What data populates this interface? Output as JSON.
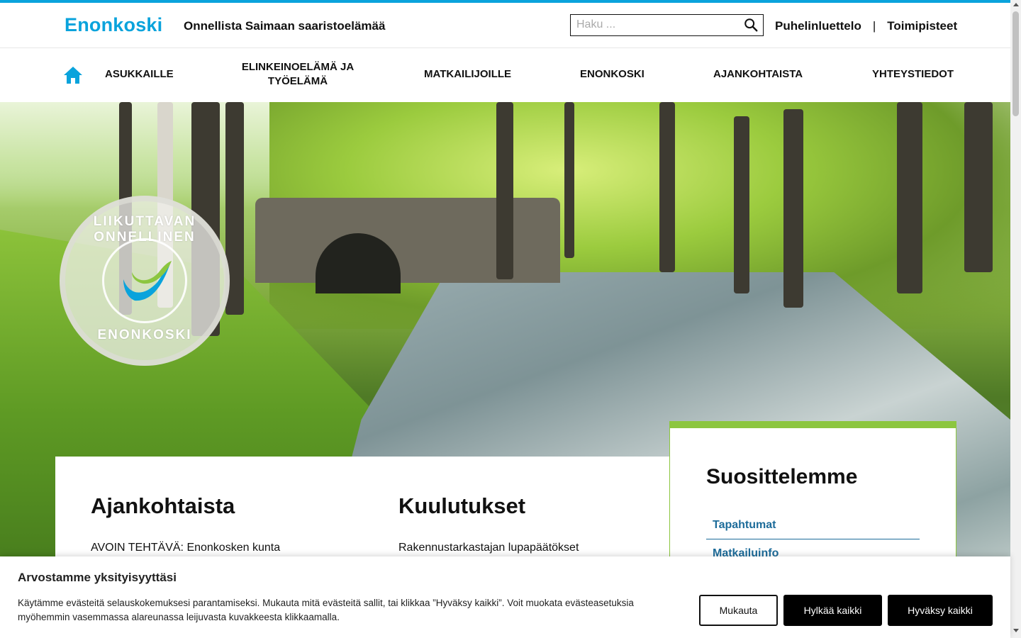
{
  "header": {
    "logo": "Enonkoski",
    "tagline": "Onnellista Saimaan saaristoelämää",
    "search_placeholder": "Haku ...",
    "links": [
      "Puhelinluettelo",
      "Toimipisteet"
    ],
    "separator": "|"
  },
  "nav": {
    "items": [
      "ASUKKAILLE",
      "ELINKEINOELÄMÄ JA TYÖELÄMÄ",
      "MATKAILIJOILLE",
      "ENONKOSKI",
      "AJANKOHTAISTA",
      "YHTEYSTIEDOT"
    ]
  },
  "hero": {
    "badge_top": "LIIKUTTAVAN ONNELLINEN",
    "badge_bottom": "ENONKOSKI"
  },
  "main": {
    "news_title": "Ajankohtaista",
    "news_first": "AVOIN TEHTÄVÄ: Enonkosken kunta",
    "announcements_title": "Kuulutukset",
    "announcements_first": "Rakennustarkastajan lupapäätökset"
  },
  "recommend": {
    "title": "Suosittelemme",
    "links": [
      "Tapahtumat",
      "Matkailuinfo"
    ]
  },
  "cookie": {
    "title": "Arvostamme yksityisyyttäsi",
    "text": "Käytämme evästeitä selauskokemuksesi parantamiseksi. Mukauta mitä evästeitä sallit, tai klikkaa ”Hyväksy kaikki”. Voit muokata evästeasetuksia myöhemmin vasemmassa alareunassa leijuvasta kuvakkeesta klikkaamalla.",
    "customize": "Mukauta",
    "reject": "Hylkää kaikki",
    "accept": "Hyväksy kaikki"
  },
  "colors": {
    "brand_blue": "#0aa3dc",
    "accent_green": "#8cc63f",
    "link_blue": "#1d6c9a"
  },
  "icons": [
    "home-icon",
    "search-icon"
  ]
}
